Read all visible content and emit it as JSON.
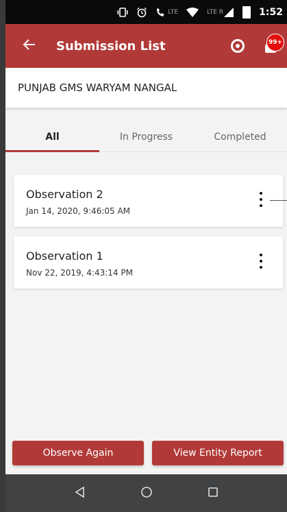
{
  "status_bar": {
    "time": "1:52",
    "lte_label": "LTE",
    "roaming_lte_label": "LTE R",
    "icons": [
      "vibrate-icon",
      "alarm-icon",
      "wifi-calling-icon",
      "wifi-icon",
      "signal-icon",
      "battery-icon"
    ]
  },
  "app_bar": {
    "title": "Submission List",
    "back_icon": "arrow-left-icon",
    "target_icon": "target-icon",
    "notification_icon": "bell-icon",
    "notification_badge": "99+"
  },
  "entity": {
    "name": "PUNJAB GMS WARYAM NANGAL"
  },
  "tabs": [
    {
      "label": "All",
      "active": true
    },
    {
      "label": "In Progress",
      "active": false
    },
    {
      "label": "Completed",
      "active": false
    }
  ],
  "submissions": [
    {
      "title": "Observation 2",
      "date": "Jan 14, 2020, 9:46:05 AM"
    },
    {
      "title": "Observation 1",
      "date": "Nov 22, 2019, 4:43:14 PM"
    }
  ],
  "actions": {
    "observe_again": "Observe Again",
    "view_entity_report": "View Entity Report"
  },
  "colors": {
    "primary": "#b13a38",
    "badge": "#e50c0c",
    "navbar": "#404244"
  }
}
